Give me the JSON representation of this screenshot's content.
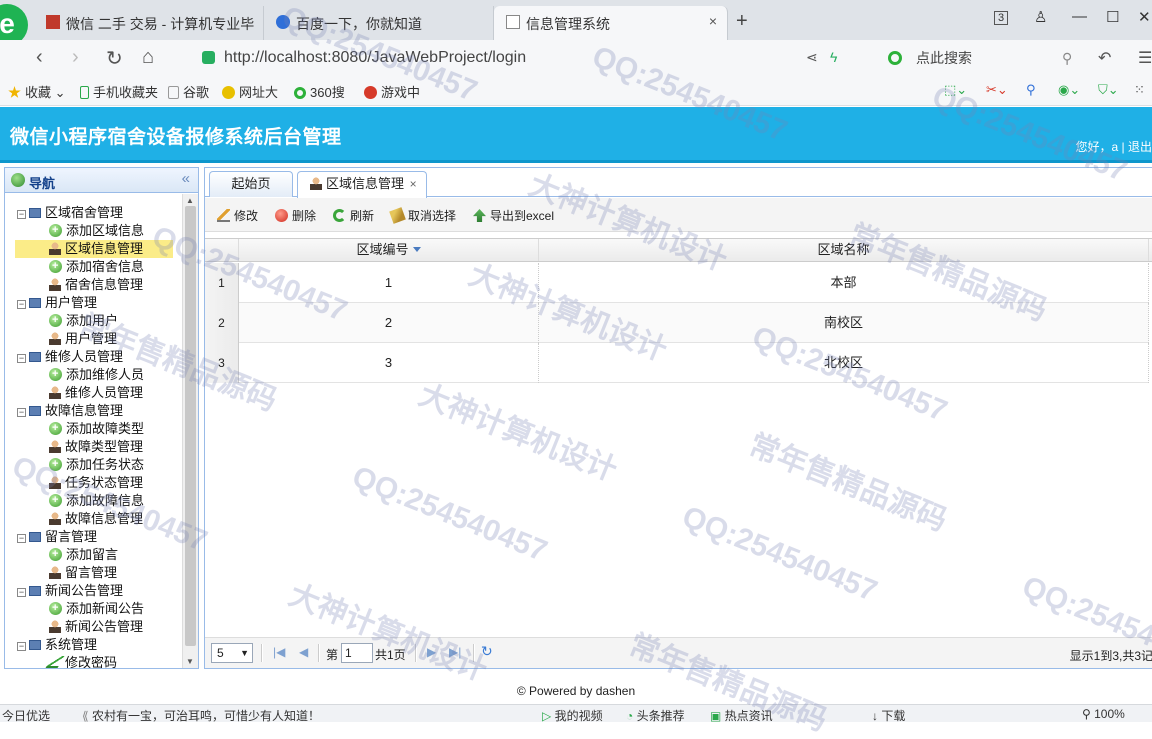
{
  "browser": {
    "tabs": [
      {
        "label": "微信 二手 交易 - 计算机专业毕"
      },
      {
        "label": "百度一下，你就知道"
      },
      {
        "label": "信息管理系统",
        "close": "×"
      }
    ],
    "new_tab": "+",
    "window_controls": {
      "count": "3",
      "minimize": "—",
      "maximize": "☐",
      "close": "✕"
    },
    "url": "http://localhost:8080/JavaWebProject/login",
    "search_placeholder": "点此搜索",
    "bookmarks": [
      {
        "label": "收藏"
      },
      {
        "label": "手机收藏夹"
      },
      {
        "label": "谷歌"
      },
      {
        "label": "网址大"
      },
      {
        "label": "360搜"
      },
      {
        "label": "游戏中"
      }
    ]
  },
  "app": {
    "title": "微信小程序宿舍设备报修系统后台管理",
    "user_greeting": "您好，a | 退出"
  },
  "nav": {
    "title": "导航",
    "collapse": "«",
    "tree": [
      {
        "label": "区域宿舍管理",
        "kind": "group",
        "expander": "−"
      },
      {
        "label": "添加区域信息",
        "kind": "add"
      },
      {
        "label": "区域信息管理",
        "kind": "manage",
        "selected": true
      },
      {
        "label": "添加宿舍信息",
        "kind": "add"
      },
      {
        "label": "宿舍信息管理",
        "kind": "manage"
      },
      {
        "label": "用户管理",
        "kind": "group",
        "expander": "−"
      },
      {
        "label": "添加用户",
        "kind": "add"
      },
      {
        "label": "用户管理",
        "kind": "manage"
      },
      {
        "label": "维修人员管理",
        "kind": "group",
        "expander": "−"
      },
      {
        "label": "添加维修人员",
        "kind": "add"
      },
      {
        "label": "维修人员管理",
        "kind": "manage"
      },
      {
        "label": "故障信息管理",
        "kind": "group",
        "expander": "−"
      },
      {
        "label": "添加故障类型",
        "kind": "add"
      },
      {
        "label": "故障类型管理",
        "kind": "manage"
      },
      {
        "label": "添加任务状态",
        "kind": "add"
      },
      {
        "label": "任务状态管理",
        "kind": "manage"
      },
      {
        "label": "添加故障信息",
        "kind": "add"
      },
      {
        "label": "故障信息管理",
        "kind": "manage"
      },
      {
        "label": "留言管理",
        "kind": "group",
        "expander": "−"
      },
      {
        "label": "添加留言",
        "kind": "add"
      },
      {
        "label": "留言管理",
        "kind": "manage"
      },
      {
        "label": "新闻公告管理",
        "kind": "group",
        "expander": "−"
      },
      {
        "label": "添加新闻公告",
        "kind": "add"
      },
      {
        "label": "新闻公告管理",
        "kind": "manage"
      },
      {
        "label": "系统管理",
        "kind": "group",
        "expander": "−"
      },
      {
        "label": "修改密码",
        "kind": "edit"
      }
    ]
  },
  "content": {
    "tabs": {
      "home": "起始页",
      "active": "区域信息管理",
      "close": "×"
    },
    "toolbar": {
      "edit": "修改",
      "delete": "删除",
      "refresh": "刷新",
      "cancel_select": "取消选择",
      "export": "导出到excel"
    },
    "grid": {
      "columns": {
        "id": "区域编号",
        "name": "区域名称"
      },
      "rows": [
        {
          "rownum": "1",
          "id": "1",
          "name": "本部"
        },
        {
          "rownum": "2",
          "id": "2",
          "name": "南校区"
        },
        {
          "rownum": "3",
          "id": "3",
          "name": "北校区"
        }
      ]
    },
    "pager": {
      "page_size": "5",
      "page_prefix": "第",
      "page_value": "1",
      "page_suffix": "共1页",
      "info": "显示1到3,共3记"
    }
  },
  "footer": "© Powered by dashen",
  "statusbar": {
    "left": "今日优选",
    "news": "农村有一宝，可治耳鸣，可惜少有人知道！",
    "video": "我的视频",
    "headline": "头条推荐",
    "hot": "热点资讯",
    "download": "下载",
    "zoom": "100%"
  },
  "watermarks": [
    "QQ:254540457",
    "大神计算机设计",
    "常年售精品源码"
  ]
}
